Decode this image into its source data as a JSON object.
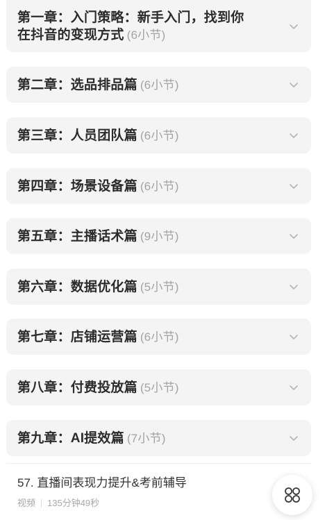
{
  "chapters": [
    {
      "title_line1": "第一章：入门策略：新手入门，找到你",
      "title_line2": "在抖音的变现方式",
      "count": "(6小节)"
    },
    {
      "title": "第二章：选品排品篇",
      "count": "(6小节)"
    },
    {
      "title": "第三章：人员团队篇",
      "count": "(6小节)"
    },
    {
      "title": "第四章：场景设备篇",
      "count": "(6小节)"
    },
    {
      "title": "第五章：主播话术篇",
      "count": "(9小节)"
    },
    {
      "title": "第六章：数据优化篇",
      "count": "(5小节)"
    },
    {
      "title": "第七章：店铺运营篇",
      "count": "(6小节)"
    },
    {
      "title": "第八章：付费投放篇",
      "count": "(5小节)"
    },
    {
      "title": "第九章：AI提效篇",
      "count": "(7小节)"
    }
  ],
  "lesson": {
    "title": "57. 直播间表现力提升&考前辅导",
    "type": "视频",
    "duration": "135分钟49秒"
  },
  "icons": {
    "chevron": "chevron-down-icon",
    "fab": "menu-grid-icon"
  },
  "colors": {
    "card_bg": "#f4f4f5",
    "title_text": "#2b2b2b",
    "muted_text": "#a3a3a3"
  }
}
